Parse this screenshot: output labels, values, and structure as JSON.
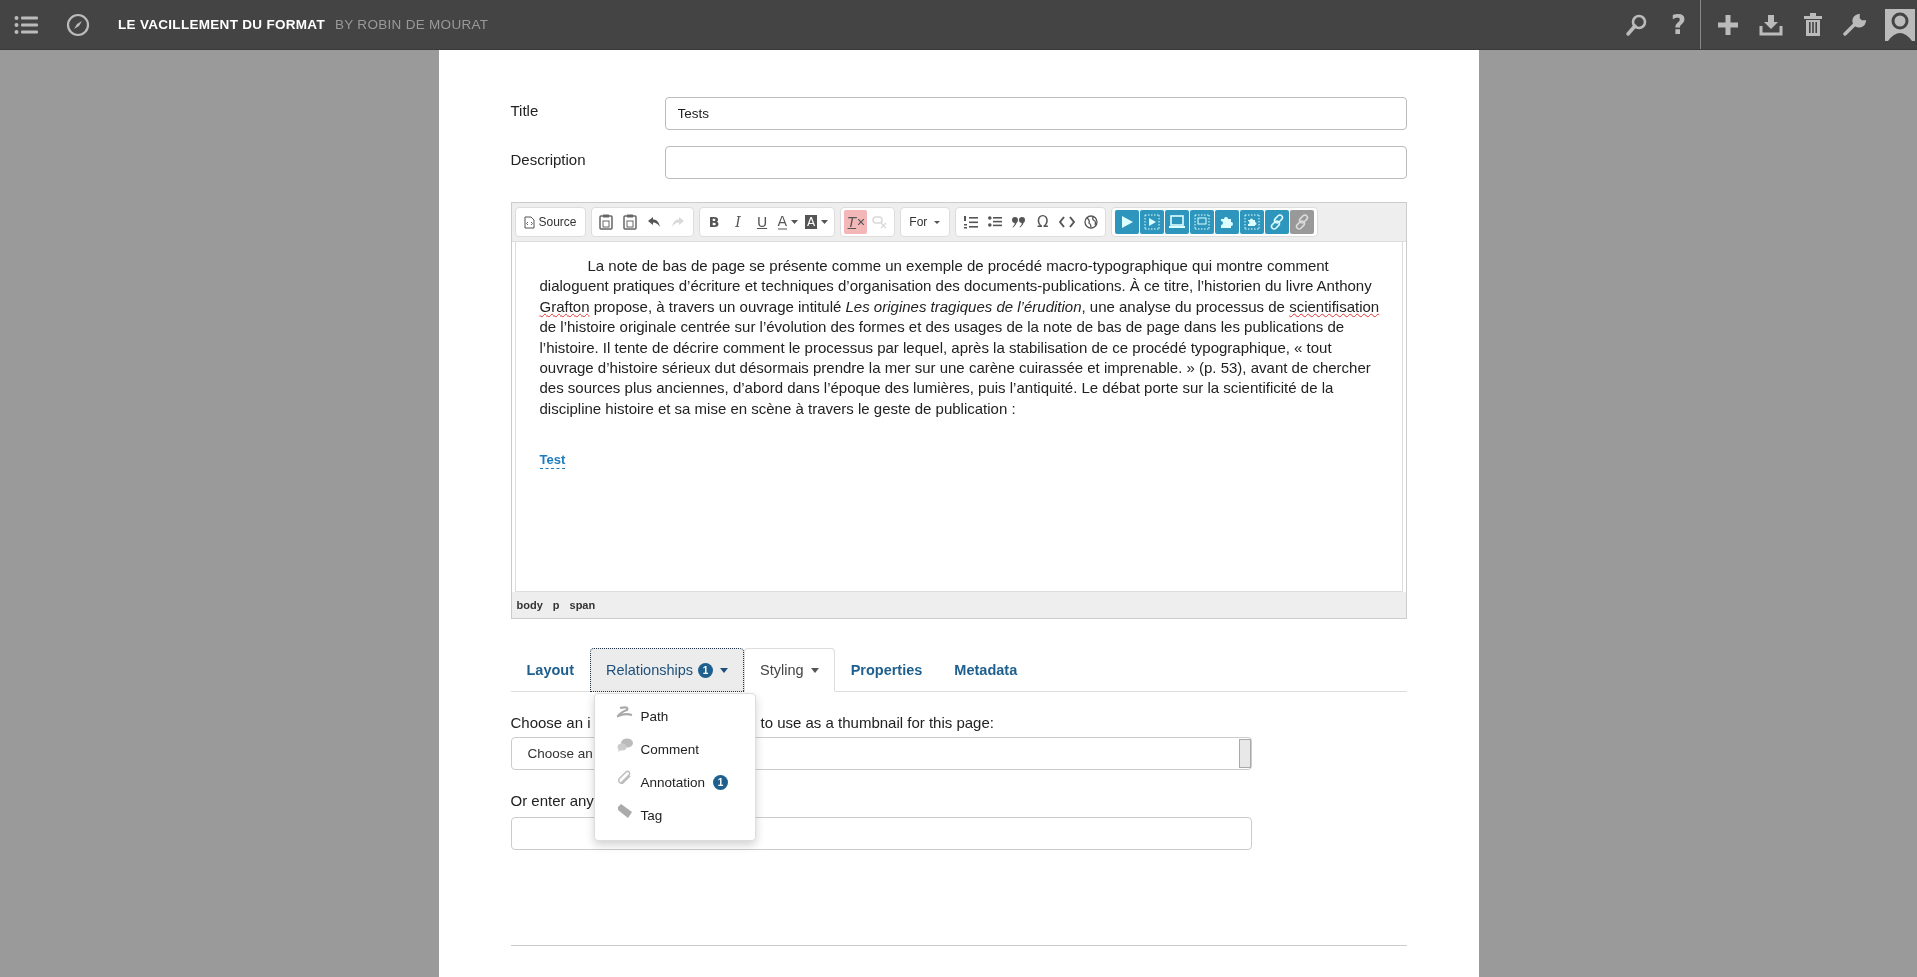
{
  "topbar": {
    "title": "LE VACILLEMENT DU FORMAT",
    "byline": "BY ROBIN DE MOURAT",
    "help": "?"
  },
  "form": {
    "title_label": "Title",
    "title_value": "Tests",
    "description_label": "Description"
  },
  "toolbar": [
    [
      {
        "kind": "source",
        "label": "Source",
        "disabled": false,
        "on": false
      }
    ],
    [
      {
        "kind": "paste-text",
        "disabled": false,
        "on": false
      },
      {
        "kind": "paste-word",
        "disabled": false,
        "on": false
      },
      {
        "kind": "undo",
        "disabled": false,
        "on": false
      },
      {
        "kind": "redo",
        "disabled": true,
        "on": false
      }
    ],
    [
      {
        "kind": "bold",
        "glyph": "B",
        "disabled": false,
        "on": false
      },
      {
        "kind": "italic",
        "glyph": "I",
        "disabled": false,
        "on": false
      },
      {
        "kind": "underline",
        "glyph": "U",
        "disabled": false,
        "on": false
      },
      {
        "kind": "text-color",
        "glyph": "A",
        "disabled": false,
        "on": false
      },
      {
        "kind": "background-color",
        "glyph": "A",
        "disabled": false,
        "on": false
      }
    ],
    [
      {
        "kind": "remove-format",
        "glyph": "T",
        "disabled": false,
        "on": true
      },
      {
        "kind": "remove-style",
        "disabled": true,
        "on": false
      }
    ],
    [
      {
        "kind": "format",
        "label": "For",
        "disabled": false,
        "on": false
      }
    ],
    [
      {
        "kind": "numbered-list",
        "disabled": false,
        "on": false
      },
      {
        "kind": "bulleted-list",
        "disabled": false,
        "on": false
      },
      {
        "kind": "blockquote",
        "disabled": false,
        "on": false
      },
      {
        "kind": "special-character",
        "glyph": "Ω",
        "disabled": false,
        "on": false
      },
      {
        "kind": "code",
        "disabled": false,
        "on": false
      },
      {
        "kind": "language",
        "disabled": false,
        "on": false
      }
    ],
    [
      {
        "kind": "play",
        "disabled": false,
        "on": false
      },
      {
        "kind": "media",
        "disabled": false,
        "on": false
      },
      {
        "kind": "laptop",
        "disabled": false,
        "on": false
      },
      {
        "kind": "frame",
        "disabled": false,
        "on": false
      },
      {
        "kind": "puzzle",
        "disabled": false,
        "on": false
      },
      {
        "kind": "puzzle-frame",
        "disabled": false,
        "on": false
      },
      {
        "kind": "link",
        "disabled": false,
        "on": false
      },
      {
        "kind": "unlink",
        "disabled": true,
        "on": false
      }
    ]
  ],
  "editor": {
    "paragraph": [
      {
        "text": "La note de bas de page se présente comme un exemple de procédé macro-typographique qui montre comment dialoguent pratiques d’écriture et techniques d’organisation des documents-publications. À ce titre, l’historien du livre Anthony ",
        "misspelled": false
      },
      {
        "text": "Grafton",
        "misspelled": true
      },
      {
        "text": " propose, à travers un ouvrage intitulé *Les origines tragiques de l’érudition*, une analyse du processus de ",
        "misspelled": false
      },
      {
        "text": "scientifisation",
        "misspelled": true
      },
      {
        "text": " de l’histoire originale centrée sur l’évolution des formes et des usages de la note de bas de page dans les publications de l’histoire. Il tente de décrire comment le processus par lequel, après la stabilisation de ce procédé typographique, « tout ouvrage d’histoire sérieux dut désormais prendre la mer sur une carène cuirassée et imprenable.  »  (p. 53), avant de chercher des sources plus anciennes, d’abord dans l’époque des lumières, puis l’antiquité. Le débat porte sur la scientificité de la discipline histoire et sa mise en scène à travers le geste de publication :",
        "misspelled": false
      }
    ],
    "link": "Test",
    "path": [
      "body",
      "p",
      "span"
    ]
  },
  "tabs": [
    {
      "label": "Layout",
      "selected": false,
      "expanded": false,
      "dropdown": false
    },
    {
      "label": "Relationships",
      "badge": "1",
      "selected": false,
      "expanded": true,
      "dropdown": true
    },
    {
      "label": "Styling",
      "selected": true,
      "expanded": false,
      "dropdown": true
    },
    {
      "label": "Properties",
      "selected": false,
      "expanded": false,
      "dropdown": false
    },
    {
      "label": "Metadata",
      "selected": false,
      "expanded": false,
      "dropdown": false
    }
  ],
  "menu": [
    {
      "kind": "path",
      "label": "Path"
    },
    {
      "kind": "comment",
      "label": "Comment"
    },
    {
      "kind": "annotation",
      "label": "Annotation",
      "badge": "1"
    },
    {
      "kind": "tag",
      "label": "Tag"
    }
  ],
  "thumbnail": {
    "label_start": "Choose an i",
    "label_end": "to use as a thumbnail for this page:",
    "select_value": "Choose an",
    "url_label": "Or enter any"
  }
}
